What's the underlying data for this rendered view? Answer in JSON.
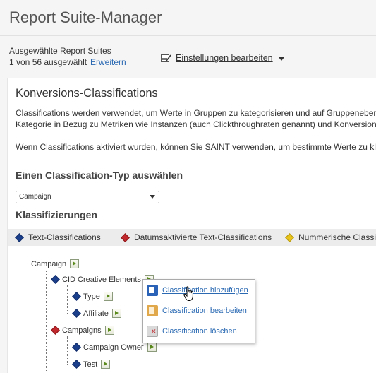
{
  "app": {
    "title": "Report Suite-Manager"
  },
  "suites": {
    "label": "Ausgewählte Report Suites",
    "count": "1 von 56 ausgewählt",
    "expand": "Erweitern"
  },
  "settings": {
    "label": "Einstellungen bearbeiten",
    "icon": "settings-edit-icon"
  },
  "main": {
    "title": "Konversions-Classifications",
    "para1_line1": "Classifications werden verwendet, um Werte in Gruppen zu kategorisieren und auf Gruppenebene",
    "para1_line2": "Kategorie in Bezug zu Metriken wie Instanzen (auch Clickthroughraten genannt) und Konversion i",
    "para2": "Wenn Classifications aktiviert wurden, können Sie SAINT verwenden, um bestimmte Werte zu klas",
    "select_heading": "Einen Classification-Typ auswählen",
    "select_value": "Campaign",
    "classifications_heading": "Klassifizierungen"
  },
  "legend": [
    {
      "label": "Text-Classifications",
      "color": "#1b3f8b"
    },
    {
      "label": "Datumsaktivierte Text-Classifications",
      "color": "#c0282d"
    },
    {
      "label": "Nummerische Classif",
      "color": "#e8c41a"
    }
  ],
  "tree": {
    "root": "Campaign",
    "cid": "CID Creative Elements",
    "type": "Type",
    "affiliate": "Affiliate",
    "campaigns": "Campaigns",
    "campaign_owner": "Campaign Owner",
    "test": "Test"
  },
  "context_menu": {
    "add": "Classification hinzufügen",
    "edit": "Classification bearbeiten",
    "delete": "Classification löschen"
  }
}
